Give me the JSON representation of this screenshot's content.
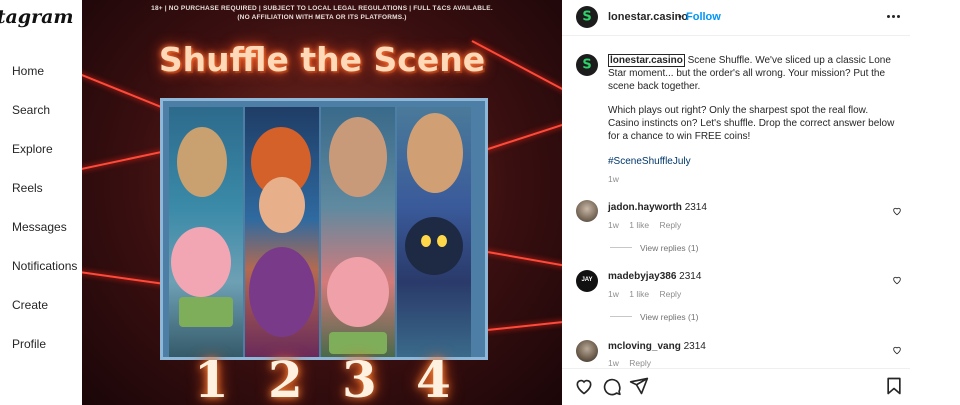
{
  "sidebar": {
    "logo": "stagram",
    "items": [
      {
        "label": "Home"
      },
      {
        "label": "Search"
      },
      {
        "label": "Explore"
      },
      {
        "label": "Reels"
      },
      {
        "label": "Messages"
      },
      {
        "label": "Notifications"
      },
      {
        "label": "Create"
      },
      {
        "label": "Profile"
      }
    ]
  },
  "media": {
    "disclaimer_line1": "18+ | NO PURCHASE REQUIRED | SUBJECT TO LOCAL LEGAL REGULATIONS | FULL T&CS AVAILABLE.",
    "disclaimer_line2": "(NO AFFILIATION WITH META OR ITS PLATFORMS.)",
    "headline": "Shuffle the Scene",
    "numbers": [
      "1",
      "2",
      "3",
      "4"
    ]
  },
  "post": {
    "author": "lonestar.casino",
    "separator": "•",
    "follow_label": "Follow",
    "avatar_letter": "S",
    "caption": {
      "mention": "lonestar.casino",
      "paragraph1": " Scene Shuffle. We've sliced up a classic Lone Star moment... but the order's all wrong. Your mission? Put the scene back together.",
      "paragraph2": "Which plays out right? Only the sharpest spot the real flow. Casino instincts on? Let's shuffle. Drop the correct answer below for a chance to win FREE coins!",
      "hashtag": "#SceneShuffleJuly",
      "time": "1w"
    },
    "comments": [
      {
        "user": "jadon.hayworth",
        "text": "2314",
        "time": "1w",
        "likes": "1 like",
        "reply_label": "Reply",
        "view_replies": "View replies (1)"
      },
      {
        "user": "madebyjay386",
        "text": "2314",
        "time": "1w",
        "likes": "1 like",
        "reply_label": "Reply",
        "view_replies": "View replies (1)",
        "avatar_text": "JAY"
      },
      {
        "user": "mcloving_vang",
        "text": "2314",
        "time": "1w",
        "reply_label": "Reply"
      }
    ]
  },
  "colors": {
    "accent": "#0095f6",
    "brand_green": "#2ed26a",
    "laser": "#ff4a3a"
  },
  "icons": [
    "more-icon",
    "heart-icon",
    "comment-icon",
    "share-icon",
    "bookmark-icon"
  ]
}
